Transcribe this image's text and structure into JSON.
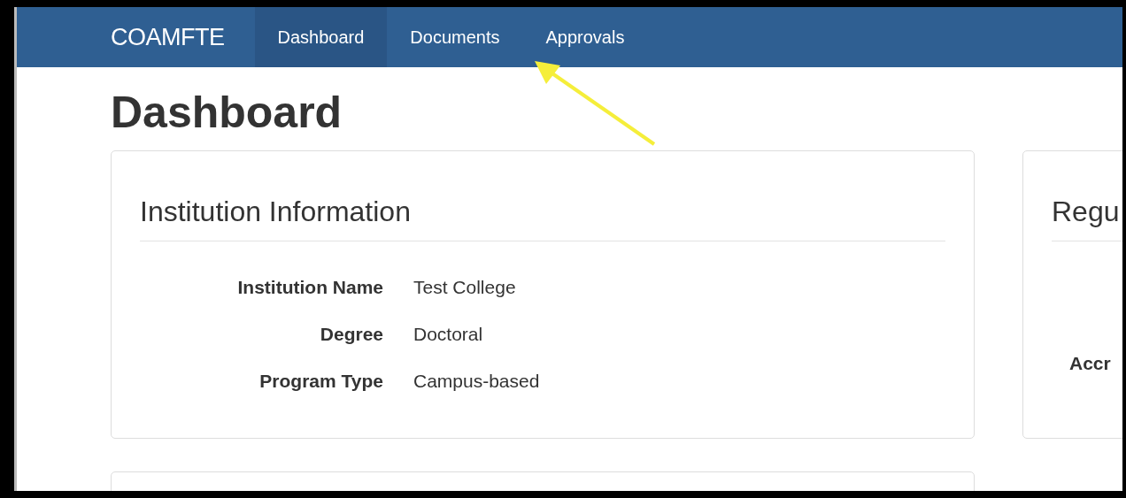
{
  "navbar": {
    "brand": "COAMFTE",
    "items": [
      {
        "label": "Dashboard",
        "selected": true
      },
      {
        "label": "Documents",
        "selected": false
      },
      {
        "label": "Approvals",
        "selected": false
      }
    ]
  },
  "annotation": {
    "kind": "arrow"
  },
  "page_title": "Dashboard",
  "institution_card": {
    "title": "Institution Information",
    "fields": [
      {
        "label": "Institution Name",
        "value": "Test College"
      },
      {
        "label": "Degree",
        "value": "Doctoral"
      },
      {
        "label": "Program Type",
        "value": "Campus-based"
      }
    ]
  },
  "side_card": {
    "title": "Regu",
    "label": "Accr"
  }
}
